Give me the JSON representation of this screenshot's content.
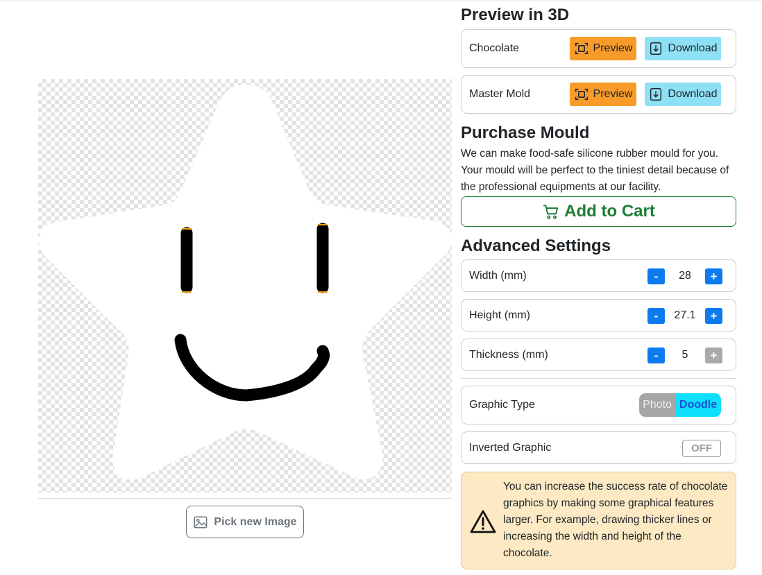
{
  "preview": {
    "title": "Preview in 3D",
    "rows": [
      {
        "label": "Chocolate",
        "preview_label": "Preview",
        "download_label": "Download"
      },
      {
        "label": "Master Mold",
        "preview_label": "Preview",
        "download_label": "Download"
      }
    ]
  },
  "purchase": {
    "title": "Purchase Mould",
    "description": "We can make food-safe silicone rubber mould for you. Your mould will be perfect to the tiniest detail because of the professional equipments at our facility.",
    "cart_label": "Add to Cart"
  },
  "advanced": {
    "title": "Advanced Settings",
    "width": {
      "label": "Width (mm)",
      "value": "28"
    },
    "height": {
      "label": "Height (mm)",
      "value": "27.1"
    },
    "thickness": {
      "label": "Thickness (mm)",
      "value": "5"
    },
    "minus": "-",
    "plus": "+",
    "graphic_type": {
      "label": "Graphic Type",
      "options": [
        "Photo",
        "Doodle"
      ],
      "selected": "Doodle"
    },
    "inverted": {
      "label": "Inverted Graphic",
      "state": "OFF"
    }
  },
  "warning": {
    "text": "You can increase the success rate of chocolate graphics by making some graphical features larger. For example, drawing thicker lines or increasing the width and height of the chocolate."
  },
  "image_panel": {
    "pick_label": "Pick new Image"
  },
  "colors": {
    "preview_button": "#f89b2a",
    "download_button": "#8ee0f5",
    "cart_green": "#1e7e34",
    "stepper_blue": "#0d7bf0",
    "doodle_cyan": "#0ee0fb",
    "warning_bg": "#fde9c4"
  }
}
